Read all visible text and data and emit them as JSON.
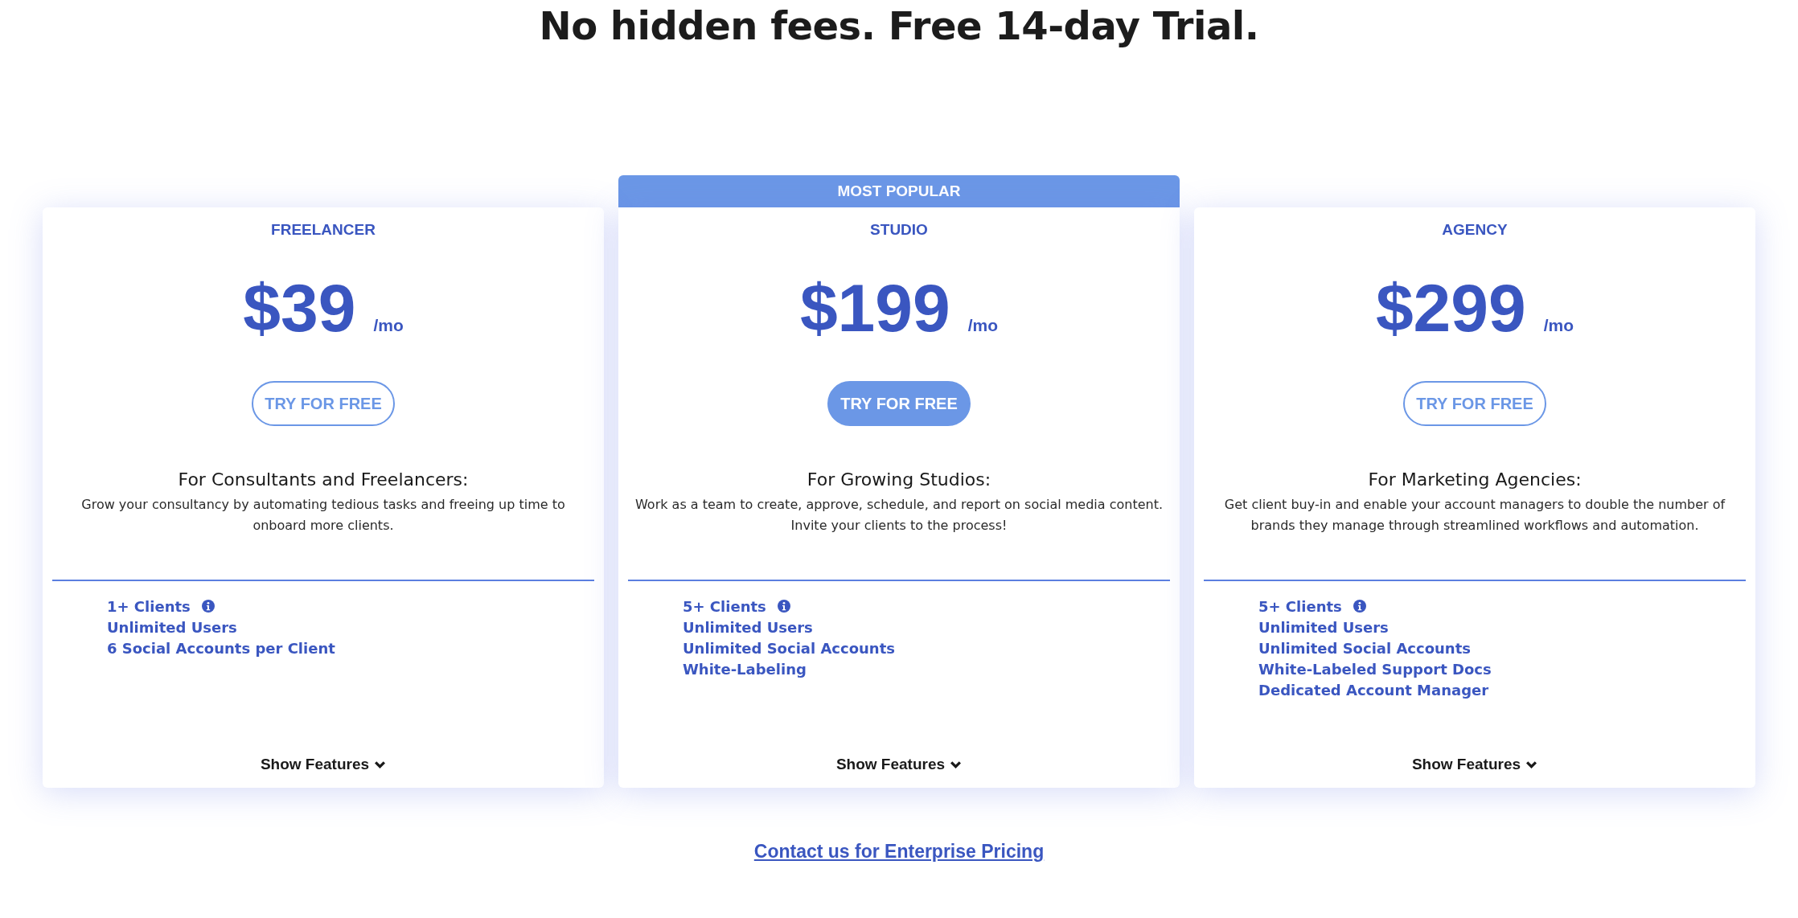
{
  "heading": "No hidden fees. Free 14-day Trial.",
  "plans": [
    {
      "name": "FREELANCER",
      "highlighted": false,
      "price": "$39",
      "period": "/mo",
      "button": "TRY FOR FREE",
      "audience": "For Consultants and Freelancers:",
      "description": "Grow your consultancy by automating tedious tasks and freeing up time to onboard more clients.",
      "features": [
        {
          "label": "1+ Clients",
          "info": true
        },
        {
          "label": "Unlimited Users",
          "info": false
        },
        {
          "label": "6 Social Accounts per Client",
          "info": false
        }
      ],
      "toggle": "Show Features"
    },
    {
      "badge": "MOST POPULAR",
      "name": "STUDIO",
      "highlighted": true,
      "price": "$199",
      "period": "/mo",
      "button": "TRY FOR FREE",
      "audience": "For Growing Studios:",
      "description": "Work as a team to create, approve, schedule, and report on social media content. Invite your clients to the process!",
      "features": [
        {
          "label": "5+ Clients",
          "info": true
        },
        {
          "label": "Unlimited Users",
          "info": false
        },
        {
          "label": "Unlimited Social Accounts",
          "info": false
        },
        {
          "label": "White-Labeling",
          "info": false
        }
      ],
      "toggle": "Show Features"
    },
    {
      "name": "AGENCY",
      "highlighted": false,
      "price": "$299",
      "period": "/mo",
      "button": "TRY FOR FREE",
      "audience": "For Marketing Agencies:",
      "description": "Get client buy-in and enable your account managers to double the number of brands they manage through streamlined workflows and automation.",
      "features": [
        {
          "label": "5+ Clients",
          "info": true
        },
        {
          "label": "Unlimited Users",
          "info": false
        },
        {
          "label": "Unlimited Social Accounts",
          "info": false
        },
        {
          "label": "White-Labeled Support Docs",
          "info": false
        },
        {
          "label": "Dedicated Account Manager",
          "info": false
        }
      ],
      "toggle": "Show Features"
    }
  ],
  "enterprise_link": "Contact us for Enterprise Pricing"
}
